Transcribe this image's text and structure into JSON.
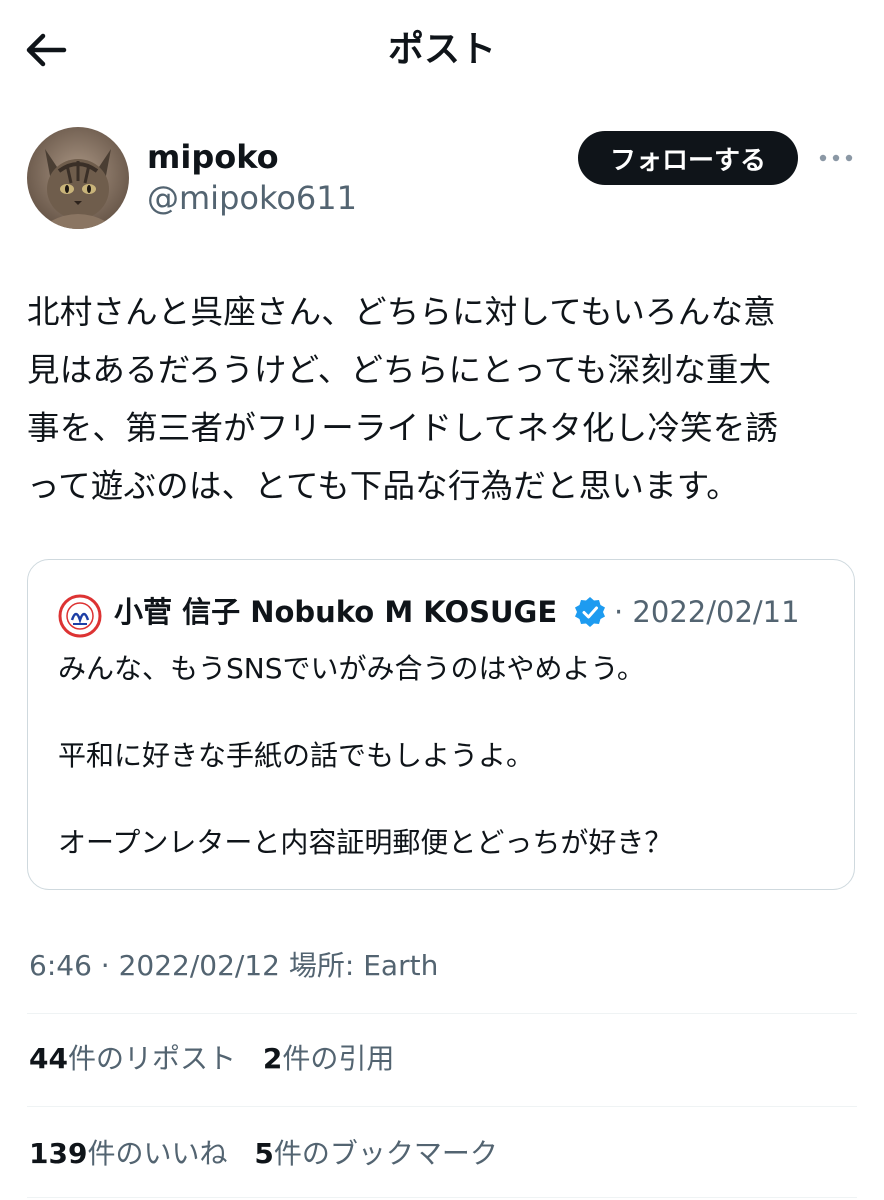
{
  "header": {
    "title": "ポスト"
  },
  "post": {
    "author": {
      "name": "mipoko",
      "handle": "@mipoko611"
    },
    "follow_label": "フォローする",
    "text_lines": [
      "北村さんと呉座さん、どちらに対してもいろんな意",
      "見はあるだろうけど、どちらにとっても深刻な重大",
      "事を、第三者がフリーライドしてネタ化し冷笑を誘",
      "って遊ぶのは、とても下品な行為だと思います。"
    ]
  },
  "quote": {
    "author_name": "小菅 信子 Nobuko M KOSUGE",
    "date": "· 2022/02/11",
    "lines": [
      "みんな、もうSNSでいがみ合うのはやめよう。",
      "平和に好きな手紙の話でもしようよ。",
      "オープンレターと内容証明郵便とどっちが好き？"
    ]
  },
  "meta": {
    "time": "6:46",
    "date": "· 2022/02/12",
    "location": "場所: Earth"
  },
  "stats": {
    "reposts": {
      "count": "44",
      "label": "件のリポスト"
    },
    "quotes": {
      "count": "2",
      "label": "件の引用"
    },
    "likes": {
      "count": "139",
      "label": "件のいいね"
    },
    "bookmarks": {
      "count": "5",
      "label": "件のブックマーク"
    }
  },
  "colors": {
    "text": "#0f1419",
    "secondary": "#536471",
    "verified": "#1d9bf0",
    "border": "#cfd9de"
  }
}
